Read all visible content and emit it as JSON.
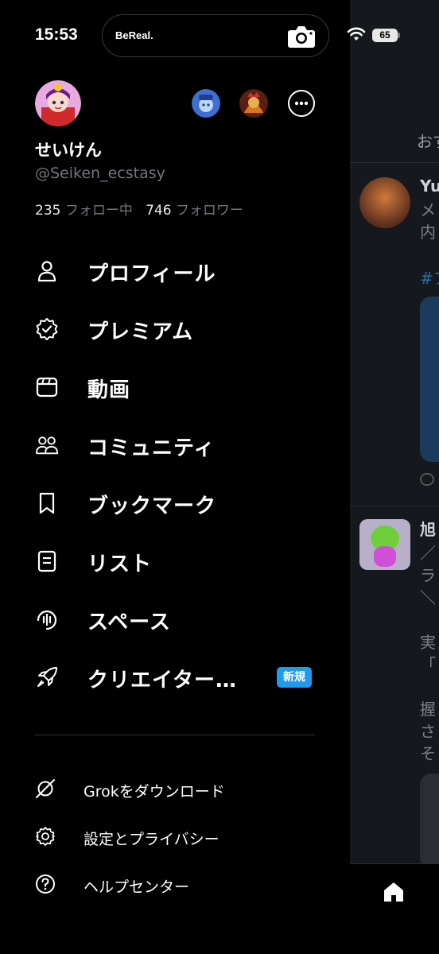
{
  "status_bar": {
    "time": "15:53",
    "island_label": "BeReal.",
    "battery": "65"
  },
  "profile": {
    "display_name": "せいけん",
    "handle": "@Seiken_ecstasy",
    "following_count": "235",
    "following_label": "フォロー中",
    "followers_count": "746",
    "followers_label": "フォロワー"
  },
  "menu": {
    "items": [
      {
        "label": "プロフィール",
        "icon": "person-icon"
      },
      {
        "label": "プレミアム",
        "icon": "verified-badge-icon"
      },
      {
        "label": "動画",
        "icon": "video-icon"
      },
      {
        "label": "コミュニティ",
        "icon": "communities-icon"
      },
      {
        "label": "ブックマーク",
        "icon": "bookmark-icon"
      },
      {
        "label": "リスト",
        "icon": "list-icon"
      },
      {
        "label": "スペース",
        "icon": "spaces-icon"
      },
      {
        "label": "クリエイター…",
        "icon": "rocket-icon",
        "badge": "新規"
      }
    ]
  },
  "secondary_menu": {
    "items": [
      {
        "label": "Grokをダウンロード",
        "icon": "grok-icon"
      },
      {
        "label": "設定とプライバシー",
        "icon": "gear-icon"
      },
      {
        "label": "ヘルプセンター",
        "icon": "help-icon"
      }
    ]
  },
  "background": {
    "tab_label": "おす",
    "post1_name": "Yu",
    "post1_line2": "メ",
    "post1_line3": "内",
    "post1_hashtag": "#フ",
    "post2_name": "旭",
    "post2_line2": "／",
    "post2_line3": "ラ",
    "post2_line4": "＼",
    "post2_line5": "実",
    "post2_line6": "「",
    "post2_line7": "握",
    "post2_line8": "さ",
    "post2_line9": "そ"
  },
  "colors": {
    "accent": "#1d9bf0",
    "background": "#000000",
    "secondary_text": "#71767b"
  }
}
